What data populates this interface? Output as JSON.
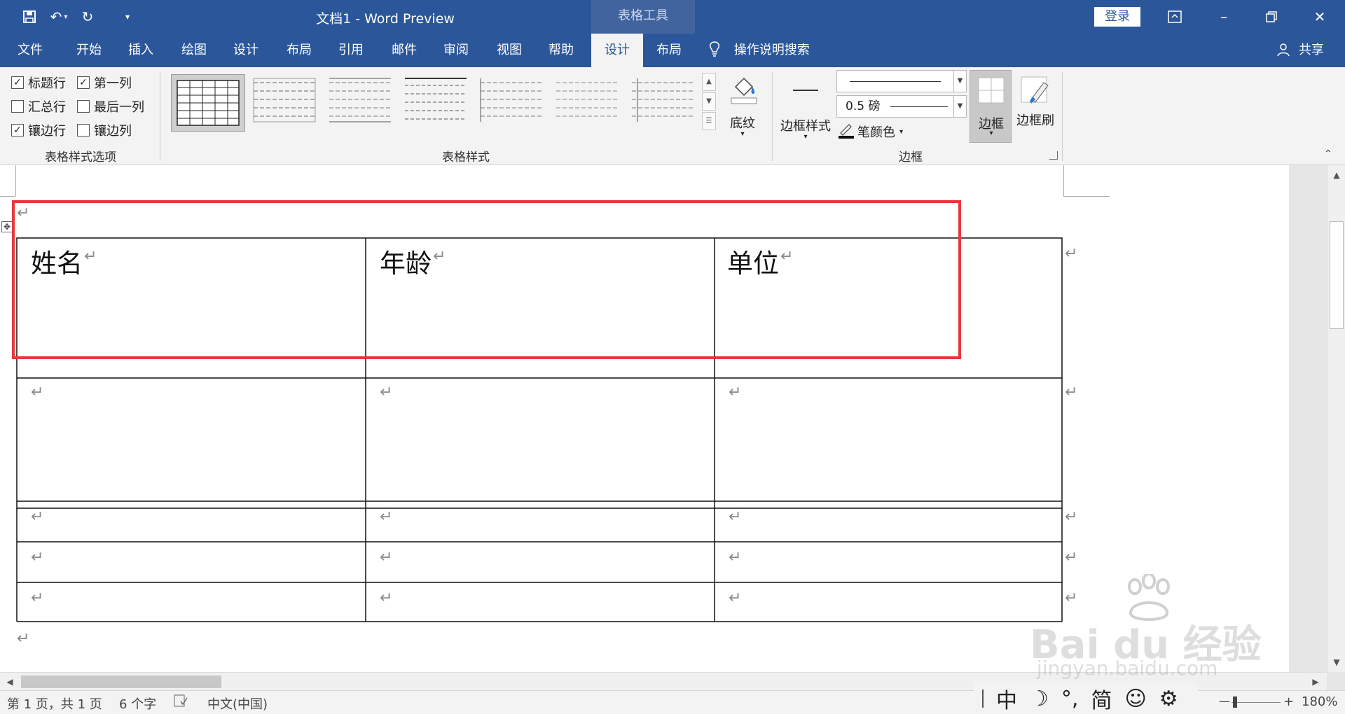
{
  "titlebar": {
    "doc_title": "文档1  -  Word Preview",
    "table_tools": "表格工具",
    "login": "登录",
    "qa_more": "▾"
  },
  "tabs": [
    {
      "label": "文件"
    },
    {
      "label": "开始"
    },
    {
      "label": "插入"
    },
    {
      "label": "绘图"
    },
    {
      "label": "设计"
    },
    {
      "label": "布局"
    },
    {
      "label": "引用"
    },
    {
      "label": "邮件"
    },
    {
      "label": "审阅"
    },
    {
      "label": "视图"
    },
    {
      "label": "帮助"
    },
    {
      "label": "设计"
    },
    {
      "label": "布局"
    }
  ],
  "tell_me": "操作说明搜索",
  "share": "共享",
  "style_options": {
    "label": "表格样式选项",
    "items": [
      {
        "label": "标题行",
        "checked": true
      },
      {
        "label": "第一列",
        "checked": true
      },
      {
        "label": "汇总行",
        "checked": false
      },
      {
        "label": "最后一列",
        "checked": false
      },
      {
        "label": "镶边行",
        "checked": true
      },
      {
        "label": "镶边列",
        "checked": false
      }
    ]
  },
  "table_styles": {
    "label": "表格样式"
  },
  "shading": "底纹",
  "borders": {
    "label": "边框",
    "border_styles": "边框样式",
    "weight": "0.5 磅",
    "pen_color": "笔颜色",
    "border_button": "边框",
    "border_painter": "边框刷"
  },
  "document": {
    "headers": [
      "姓名",
      "年龄",
      "单位"
    ],
    "para_mark": "↵"
  },
  "status": {
    "page": "第 1 页，共 1 页",
    "words": "6 个字",
    "language": "中文(中国)",
    "zoom": "180%"
  },
  "ime": [
    "中",
    "☽",
    "°,",
    "简",
    "☺",
    "⚙"
  ],
  "watermark": {
    "logo": "Bai du 经验",
    "url": "jingyan.baidu.com"
  },
  "colors": {
    "ribbon_blue": "#2b579a",
    "highlight_red": "#e8383d"
  }
}
